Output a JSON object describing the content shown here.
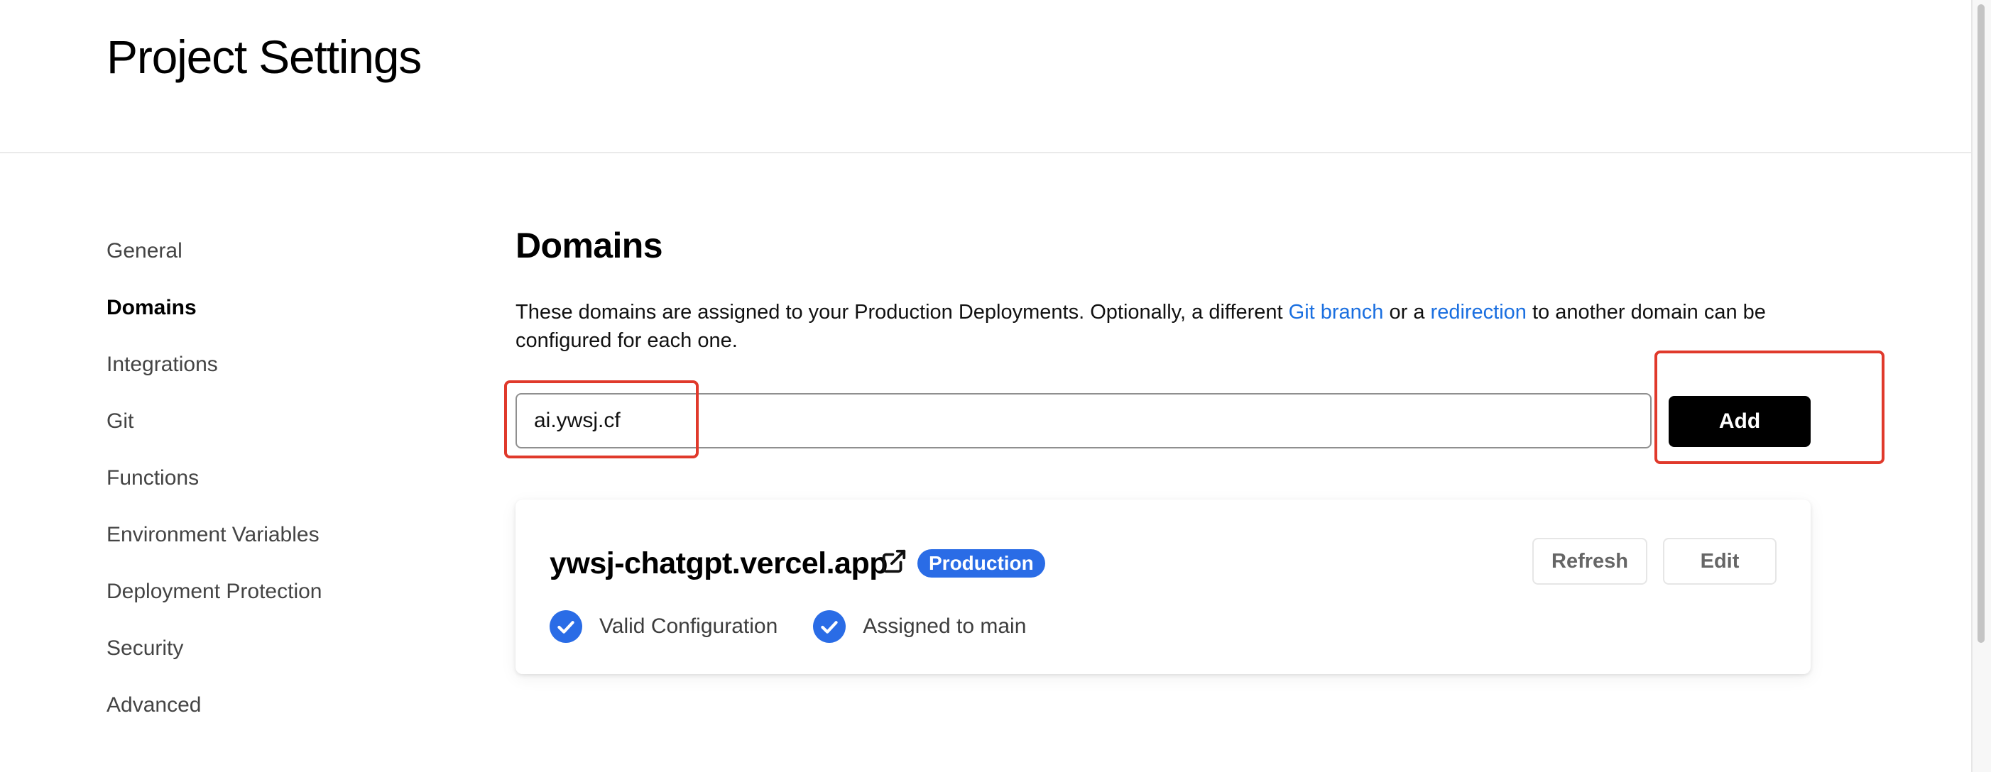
{
  "page": {
    "title": "Project Settings"
  },
  "sidebar": {
    "items": [
      {
        "label": "General",
        "active": false
      },
      {
        "label": "Domains",
        "active": true
      },
      {
        "label": "Integrations",
        "active": false
      },
      {
        "label": "Git",
        "active": false
      },
      {
        "label": "Functions",
        "active": false
      },
      {
        "label": "Environment Variables",
        "active": false
      },
      {
        "label": "Deployment Protection",
        "active": false
      },
      {
        "label": "Security",
        "active": false
      },
      {
        "label": "Advanced",
        "active": false
      }
    ]
  },
  "domains": {
    "title": "Domains",
    "description": {
      "part1": "These domains are assigned to your Production Deployments. Optionally, a different ",
      "link1": "Git branch",
      "part2": " or a ",
      "link2": "redirection",
      "part3": " to another domain can be configured for each one."
    },
    "input_value": "ai.ywsj.cf",
    "add_label": "Add",
    "highlight_color": "#e0392b",
    "card": {
      "domain": "ywsj-chatgpt.vercel.app",
      "badge": "Production",
      "badge_color": "#2a6ce6",
      "refresh_label": "Refresh",
      "edit_label": "Edit",
      "statuses": [
        {
          "icon": "check-circle-icon",
          "label": "Valid Configuration"
        },
        {
          "icon": "check-circle-icon",
          "label": "Assigned to main"
        }
      ]
    }
  },
  "colors": {
    "link": "#1a6fe0",
    "accent": "#000000"
  }
}
